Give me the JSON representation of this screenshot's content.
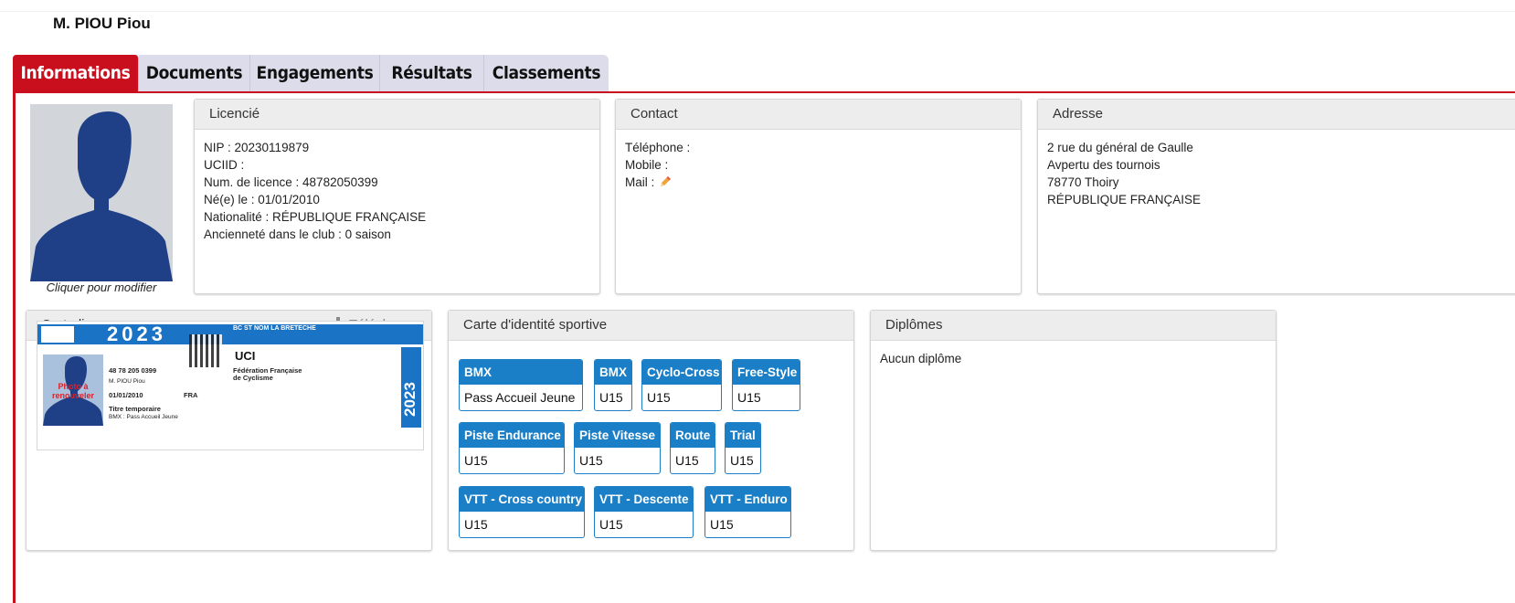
{
  "person_name": "M.  PIOU Piou",
  "tabs": [
    {
      "label": "Informations",
      "active": true
    },
    {
      "label": "Documents",
      "active": false
    },
    {
      "label": "Engagements",
      "active": false
    },
    {
      "label": "Résultats",
      "active": false
    },
    {
      "label": "Classements",
      "active": false
    }
  ],
  "photo": {
    "caption": "Cliquer pour modifier",
    "icon": "avatar-silhouette"
  },
  "licencie": {
    "title": "Licencié",
    "lines": [
      "NIP : 20230119879",
      "UCIID :",
      "Num. de licence : 48782050399",
      "Né(e) le : 01/01/2010",
      "Nationalité : RÉPUBLIQUE FRANÇAISE",
      "Ancienneté dans le club : 0 saison"
    ]
  },
  "contact": {
    "title": "Contact",
    "phone": "Téléphone :",
    "mobile": "Mobile :",
    "mail": "Mail :",
    "edit_icon": "pencil-icon"
  },
  "adresse": {
    "title": "Adresse",
    "lines": [
      "2 rue du général de Gaulle",
      "Avpertu des tournois",
      "78770  Thoiry",
      "RÉPUBLIQUE FRANÇAISE"
    ]
  },
  "carte_licence": {
    "title": "Carte licence",
    "download_label": "Télécharger",
    "card": {
      "year": "2023",
      "club": "BC ST NOM LA BRETECHE",
      "licence_no": "48 78 205 0399",
      "name": "M. PIOU Piou",
      "birth": "01/01/2010",
      "nationality": "FRA",
      "title_line": "Titre temporaire",
      "category": "BMX : Pass Accueil Jeune",
      "renew": "Photo à renouveler",
      "uci": "UCI",
      "federation": "Fédération Française de Cyclisme"
    }
  },
  "carte_identite": {
    "title": "Carte d'identité sportive",
    "badges": [
      {
        "discipline": "BMX",
        "level": "Pass Accueil Jeune"
      },
      {
        "discipline": "BMX",
        "level": "U15"
      },
      {
        "discipline": "Cyclo-Cross",
        "level": "U15"
      },
      {
        "discipline": "Free-Style",
        "level": "U15"
      },
      {
        "discipline": "Piste Endurance",
        "level": "U15"
      },
      {
        "discipline": "Piste Vitesse",
        "level": "U15"
      },
      {
        "discipline": "Route",
        "level": "U15"
      },
      {
        "discipline": "Trial",
        "level": "U15"
      },
      {
        "discipline": "VTT - Cross country",
        "level": "U15"
      },
      {
        "discipline": "VTT - Descente",
        "level": "U15"
      },
      {
        "discipline": "VTT - Enduro",
        "level": "U15"
      }
    ]
  },
  "diplomes": {
    "title": "Diplômes",
    "empty_text": "Aucun diplôme"
  },
  "colors": {
    "brand_red": "#c90e1e",
    "badge_blue": "#1a7fc7",
    "avatar_navy": "#1f3f86"
  }
}
